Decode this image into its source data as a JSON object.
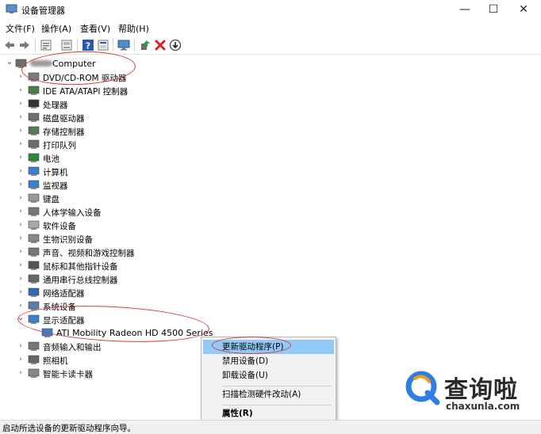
{
  "window": {
    "title": "设备管理器",
    "minimize_glyph": "—",
    "maximize_glyph": "☐",
    "close_glyph": "✕"
  },
  "menu": [
    {
      "label": "文件(F)"
    },
    {
      "label": "操作(A)"
    },
    {
      "label": "查看(V)"
    },
    {
      "label": "帮助(H)"
    }
  ],
  "toolbar": {
    "icons": [
      "back-arrow-icon",
      "forward-arrow-icon",
      "properties-icon",
      "device-list-icon",
      "help-icon",
      "view-icon",
      "monitor-icon",
      "update-driver-icon",
      "uninstall-x-icon",
      "scan-download-icon"
    ]
  },
  "tree": {
    "root": "Computer",
    "categories": [
      {
        "label": "DVD/CD-ROM 驱动器",
        "icon": "dvd-drive-icon"
      },
      {
        "label": "IDE ATA/ATAPI 控制器",
        "icon": "ide-controller-icon"
      },
      {
        "label": "处理器",
        "icon": "processor-icon"
      },
      {
        "label": "磁盘驱动器",
        "icon": "disk-drive-icon"
      },
      {
        "label": "存储控制器",
        "icon": "storage-controller-icon"
      },
      {
        "label": "打印队列",
        "icon": "printer-icon"
      },
      {
        "label": "电池",
        "icon": "battery-icon"
      },
      {
        "label": "计算机",
        "icon": "computer-icon"
      },
      {
        "label": "监视器",
        "icon": "monitor-icon"
      },
      {
        "label": "键盘",
        "icon": "keyboard-icon"
      },
      {
        "label": "人体学输入设备",
        "icon": "hid-icon"
      },
      {
        "label": "软件设备",
        "icon": "software-device-icon"
      },
      {
        "label": "生物识别设备",
        "icon": "biometric-icon"
      },
      {
        "label": "声音、视频和游戏控制器",
        "icon": "sound-icon"
      },
      {
        "label": "鼠标和其他指针设备",
        "icon": "mouse-icon"
      },
      {
        "label": "通用串行总线控制器",
        "icon": "usb-icon"
      },
      {
        "label": "网络适配器",
        "icon": "network-adapter-icon"
      },
      {
        "label": "系统设备",
        "icon": "system-device-icon"
      },
      {
        "label": "显示适配器",
        "icon": "display-adapter-icon",
        "expanded": true
      },
      {
        "label": "ATI Mobility Radeon HD 4500 Series",
        "icon": "display-adapter-icon",
        "child": true
      },
      {
        "label": "音频输入和输出",
        "icon": "audio-io-icon"
      },
      {
        "label": "照相机",
        "icon": "camera-icon"
      },
      {
        "label": "智能卡读卡器",
        "icon": "smart-card-icon"
      }
    ]
  },
  "context_menu": {
    "items": [
      {
        "label": "更新驱动程序(P)",
        "highlighted": true
      },
      {
        "label": "禁用设备(D)"
      },
      {
        "label": "卸载设备(U)"
      },
      {
        "label": "扫描检测硬件改动(A)"
      },
      {
        "label": "属性(R)",
        "bold": true
      }
    ]
  },
  "status": {
    "text": "启动所选设备的更新驱动程序向导。"
  },
  "watermark": {
    "brand": "查询啦",
    "url": "chaxunla.com"
  },
  "colors": {
    "highlight": "#91c9f7",
    "annotation": "#d8383f",
    "watermark_blue": "#2f7fe0",
    "watermark_orange": "#f29a1f"
  }
}
